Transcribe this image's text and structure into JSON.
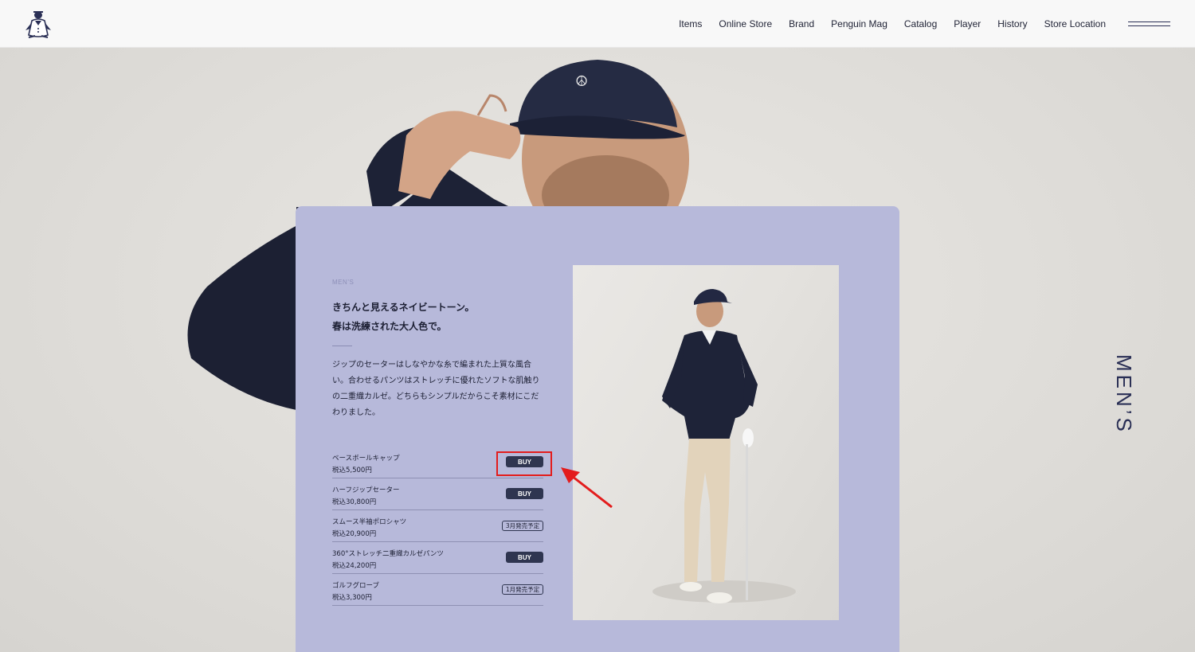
{
  "header": {
    "nav": [
      "Items",
      "Online Store",
      "Brand",
      "Penguin Mag",
      "Catalog",
      "Player",
      "History",
      "Store Location"
    ]
  },
  "side_label": "MEN’S",
  "card": {
    "category": "MEN’S",
    "headline": [
      "きちんと見えるネイビートーン。",
      "春は洗練された大人色で。"
    ],
    "description": [
      "ジップのセーターはしなやかな糸で編まれた上質な風合",
      "い。合わせるパンツはストレッチに優れたソフトな肌触り",
      "の二重織カルゼ。どちらもシンプルだからこそ素材にこだ",
      "わりました。"
    ],
    "products": [
      {
        "name": "ベースボールキャップ",
        "price": "税込5,500円",
        "action": "BUY"
      },
      {
        "name": "ハーフジップセーター",
        "price": "税込30,800円",
        "action": "BUY"
      },
      {
        "name": "スムース半袖ポロシャツ",
        "price": "税込20,900円",
        "action": "3月発売予定"
      },
      {
        "name": "360°ストレッチ二重織カルゼパンツ",
        "price": "税込24,200円",
        "action": "BUY"
      },
      {
        "name": "ゴルフグローブ",
        "price": "税込3,300円",
        "action": "1月発売予定"
      }
    ]
  },
  "colors": {
    "card_bg": "#b7b9da",
    "button_bg": "#2f3550",
    "highlight": "#e31c1c",
    "navy": "#2a2f55"
  },
  "icons": [
    "penguin-logo-icon",
    "hamburger-menu-icon",
    "annotation-arrow-icon"
  ]
}
